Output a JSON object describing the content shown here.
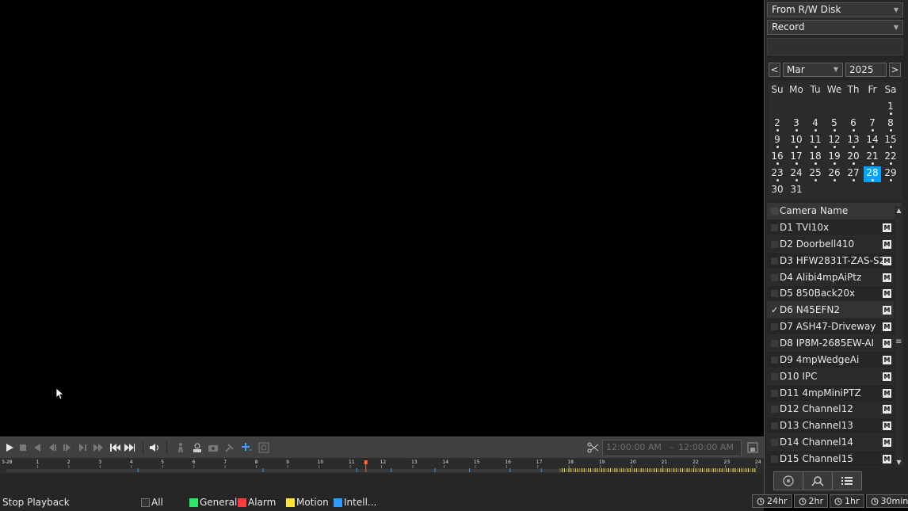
{
  "sidebar": {
    "source_select": "From R/W Disk",
    "type_select": "Record",
    "prev": "<",
    "next": ">",
    "month": "Mar",
    "year": "2025",
    "weekdays": [
      "Su",
      "Mo",
      "Tu",
      "We",
      "Th",
      "Fr",
      "Sa"
    ],
    "days": [
      "1",
      "2",
      "3",
      "4",
      "5",
      "6",
      "7",
      "8",
      "9",
      "10",
      "11",
      "12",
      "13",
      "14",
      "15",
      "16",
      "17",
      "18",
      "19",
      "20",
      "21",
      "22",
      "23",
      "24",
      "25",
      "26",
      "27",
      "28",
      "29",
      "30",
      "31"
    ],
    "selected_day": "28",
    "camera_header": "Camera Name",
    "cameras": [
      "D1 TVI10x",
      "D2 Doorbell410",
      "D3 HFW2831T-ZAS-S2",
      "D4 Alibi4mpAiPtz",
      "D5 850Back20x",
      "D6 N45EFN2",
      "D7 ASH47-Driveway",
      "D8 IP8M-2685EW-AI",
      "D9 4mpWedgeAi",
      "D10 IPC",
      "D11 4mpMiniPTZ",
      "D12 Channel12",
      "D13 Channel13",
      "D14 Channel14",
      "D15 Channel15"
    ],
    "selected_camera": "D6 N45EFN2",
    "m_label": "M",
    "check_mark": "✓"
  },
  "controls": {
    "start_time": "12:00:00 AM",
    "separator": "-",
    "end_time": "12:00:00 AM"
  },
  "timeline": {
    "start_label": "3-28",
    "hours": [
      "1",
      "2",
      "3",
      "4",
      "5",
      "6",
      "7",
      "8",
      "9",
      "10",
      "11",
      "12",
      "13",
      "14",
      "15",
      "16",
      "17",
      "18",
      "19",
      "20",
      "21",
      "22",
      "23",
      "24"
    ],
    "current_hour": 11.5
  },
  "legend": {
    "status": "Stop Playback",
    "all": "All",
    "general": "General",
    "alarm": "Alarm",
    "motion": "Motion",
    "intel": "Intell...",
    "colors": {
      "general": "#2ee66b",
      "alarm": "#ff3b3b",
      "motion": "#ffe23a",
      "intel": "#2e9bff",
      "accent": "#00a2ff"
    }
  },
  "zoom": [
    "24hr",
    "2hr",
    "1hr",
    "30min"
  ]
}
